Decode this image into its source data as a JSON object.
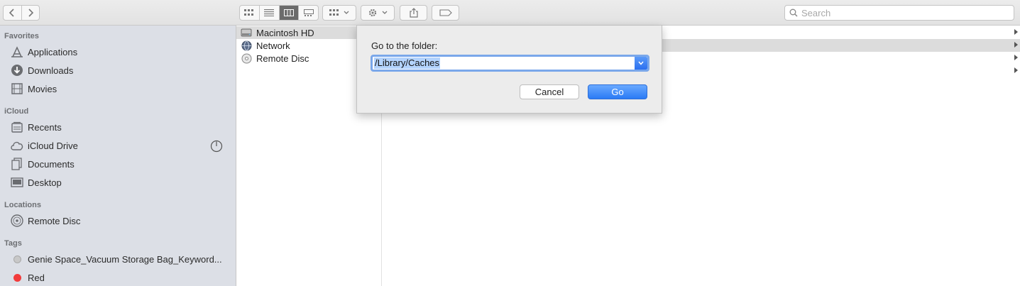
{
  "toolbar": {
    "search_placeholder": "Search"
  },
  "sidebar": {
    "favorites_title": "Favorites",
    "favorites": [
      {
        "label": "Applications",
        "icon": "applications-icon"
      },
      {
        "label": "Downloads",
        "icon": "downloads-icon"
      },
      {
        "label": "Movies",
        "icon": "movies-icon"
      }
    ],
    "icloud_title": "iCloud",
    "icloud": [
      {
        "label": "Recents",
        "icon": "recents-icon"
      },
      {
        "label": "iCloud Drive",
        "icon": "icloud-icon"
      },
      {
        "label": "Documents",
        "icon": "documents-icon"
      },
      {
        "label": "Desktop",
        "icon": "desktop-icon"
      }
    ],
    "locations_title": "Locations",
    "locations": [
      {
        "label": "Remote Disc",
        "icon": "remote-disc-icon"
      }
    ],
    "tags_title": "Tags",
    "tags": [
      {
        "label": "Genie Space_Vacuum Storage Bag_Keyword...",
        "color": "#c8c8c8"
      },
      {
        "label": "Red",
        "color": "#f23b3b"
      }
    ]
  },
  "column1": {
    "items": [
      {
        "label": "Macintosh HD",
        "icon": "hard-drive-icon"
      },
      {
        "label": "Network",
        "icon": "network-globe-icon"
      },
      {
        "label": "Remote Disc",
        "icon": "disc-icon"
      }
    ]
  },
  "dialog": {
    "title": "Go to the folder:",
    "path_value": "/Library/Caches",
    "cancel_label": "Cancel",
    "go_label": "Go"
  },
  "colors": {
    "accent": "#2a7af5",
    "sidebar_bg": "#dcdfe6",
    "selection": "#dcdcdc"
  }
}
